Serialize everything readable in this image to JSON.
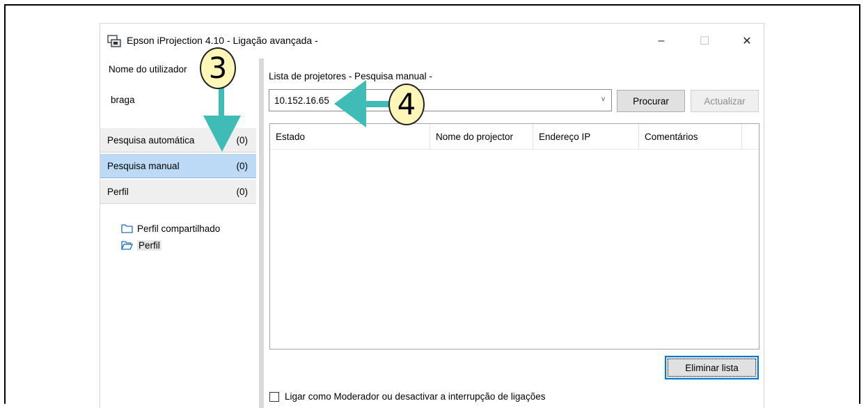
{
  "window": {
    "title": "Epson iProjection 4.10 - Ligação avançada -",
    "minimize": "–",
    "maximize": "☐",
    "close": "✕"
  },
  "left_panel": {
    "user_label": "Nome do utilizador",
    "user_value": "braga",
    "nav": [
      {
        "label": "Pesquisa automática",
        "count": "(0)"
      },
      {
        "label": "Pesquisa manual",
        "count": "(0)"
      },
      {
        "label": "Perfil",
        "count": "(0)"
      }
    ],
    "profiles": [
      {
        "label": "Perfil compartilhado",
        "icon": "folder-icon"
      },
      {
        "label": "Perfil",
        "icon": "folder-open-icon"
      }
    ]
  },
  "right_panel": {
    "list_title": "Lista de projetores - Pesquisa manual -",
    "ip_value": "10.152.16.65",
    "combo_arrow": "v",
    "search_button": "Procurar",
    "refresh_button": "Actualizar",
    "columns": [
      "Estado",
      "Nome do projector",
      "Endereço IP",
      "Comentários"
    ],
    "rows": [],
    "clear_button": "Eliminar lista",
    "moderator_label": "Ligar como Moderador ou desactivar a interrupção de ligações"
  },
  "annotations": {
    "step3": "3",
    "step4": "4",
    "arrow_color": "#3fbcb6",
    "badge_color": "#fff6b8"
  },
  "colors": {
    "selected_nav": "#bcd9f6",
    "focus_border": "#0078d7"
  }
}
